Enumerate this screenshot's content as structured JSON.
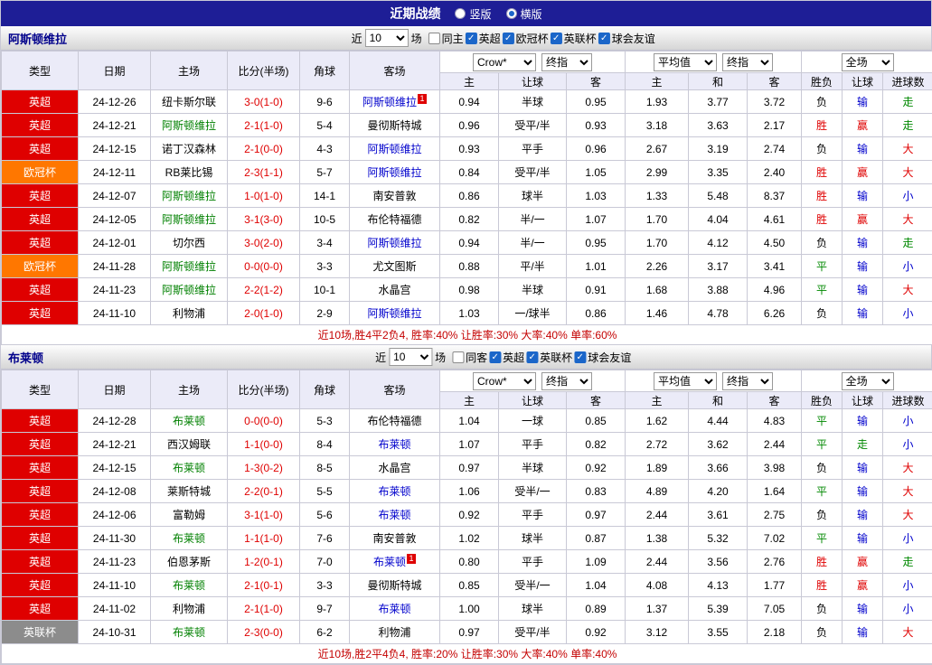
{
  "topbar": {
    "title": "近期战绩",
    "radios": [
      {
        "label": "竖版",
        "selected": false
      },
      {
        "label": "横版",
        "selected": true
      }
    ]
  },
  "colors": {
    "topbar_bg": "#1e1e96",
    "epl_badge": "#df0000",
    "ucl_badge": "#ff7700",
    "league_cup_badge": "#8c8c8c",
    "win_red": "#df0000",
    "draw_green": "#008800",
    "blue": "#0000cc",
    "home_focus_green": "#008000",
    "header_bg": "#ebebf8"
  },
  "filter": {
    "near_label": "近",
    "matches_label": "场",
    "count_value": "10"
  },
  "table": {
    "headers": [
      "类型",
      "日期",
      "主场",
      "比分(半场)",
      "角球",
      "客场"
    ],
    "odds_headers": [
      "主",
      "让球",
      "客"
    ],
    "avg_headers": [
      "主",
      "和",
      "客"
    ],
    "result_headers": [
      "胜负",
      "让球",
      "进球数"
    ],
    "selects": {
      "bookmaker": "Crow*",
      "final1": "终指",
      "avg": "平均值",
      "final2": "终指",
      "scope": "全场"
    }
  },
  "sections": [
    {
      "team": "阿斯顿维拉",
      "filter_checkboxes": [
        {
          "label": "同主",
          "checked": false
        },
        {
          "label": "英超",
          "checked": true
        },
        {
          "label": "欧冠杯",
          "checked": true
        },
        {
          "label": "英联杯",
          "checked": true
        },
        {
          "label": "球会友谊",
          "checked": true
        }
      ],
      "rows": [
        {
          "league": "英超",
          "league_color": "epl",
          "date": "24-12-26",
          "home": "纽卡斯尔联",
          "home_focus": false,
          "score": "3-0(1-0)",
          "corners": "9-6",
          "away": "阿斯顿维拉",
          "away_focus": true,
          "away_badge": "1",
          "odds": [
            "0.94",
            "半球",
            "0.95"
          ],
          "avg": [
            "1.93",
            "3.77",
            "3.72"
          ],
          "wdl": "负",
          "wdl_color": "black",
          "handicap_result": "输",
          "hr_color": "blue",
          "goals": "走",
          "goals_color": "green"
        },
        {
          "league": "英超",
          "league_color": "epl",
          "date": "24-12-21",
          "home": "阿斯顿维拉",
          "home_focus": true,
          "score": "2-1(1-0)",
          "corners": "5-4",
          "away": "曼彻斯特城",
          "away_focus": false,
          "odds": [
            "0.96",
            "受平/半",
            "0.93"
          ],
          "avg": [
            "3.18",
            "3.63",
            "2.17"
          ],
          "wdl": "胜",
          "wdl_color": "red",
          "handicap_result": "赢",
          "hr_color": "red",
          "goals": "走",
          "goals_color": "green"
        },
        {
          "league": "英超",
          "league_color": "epl",
          "date": "24-12-15",
          "home": "诺丁汉森林",
          "home_focus": false,
          "score": "2-1(0-0)",
          "corners": "4-3",
          "away": "阿斯顿维拉",
          "away_focus": true,
          "odds": [
            "0.93",
            "平手",
            "0.96"
          ],
          "avg": [
            "2.67",
            "3.19",
            "2.74"
          ],
          "wdl": "负",
          "wdl_color": "black",
          "handicap_result": "输",
          "hr_color": "blue",
          "goals": "大",
          "goals_color": "red"
        },
        {
          "league": "欧冠杯",
          "league_color": "ucl",
          "date": "24-12-11",
          "home": "RB莱比锡",
          "home_focus": false,
          "score": "2-3(1-1)",
          "corners": "5-7",
          "away": "阿斯顿维拉",
          "away_focus": true,
          "odds": [
            "0.84",
            "受平/半",
            "1.05"
          ],
          "avg": [
            "2.99",
            "3.35",
            "2.40"
          ],
          "wdl": "胜",
          "wdl_color": "red",
          "handicap_result": "赢",
          "hr_color": "red",
          "goals": "大",
          "goals_color": "red"
        },
        {
          "league": "英超",
          "league_color": "epl",
          "date": "24-12-07",
          "home": "阿斯顿维拉",
          "home_focus": true,
          "score": "1-0(1-0)",
          "corners": "14-1",
          "away": "南安普敦",
          "away_focus": false,
          "odds": [
            "0.86",
            "球半",
            "1.03"
          ],
          "avg": [
            "1.33",
            "5.48",
            "8.37"
          ],
          "wdl": "胜",
          "wdl_color": "red",
          "handicap_result": "输",
          "hr_color": "blue",
          "goals": "小",
          "goals_color": "blue"
        },
        {
          "league": "英超",
          "league_color": "epl",
          "date": "24-12-05",
          "home": "阿斯顿维拉",
          "home_focus": true,
          "score": "3-1(3-0)",
          "corners": "10-5",
          "away": "布伦特福德",
          "away_focus": false,
          "odds": [
            "0.82",
            "半/一",
            "1.07"
          ],
          "avg": [
            "1.70",
            "4.04",
            "4.61"
          ],
          "wdl": "胜",
          "wdl_color": "red",
          "handicap_result": "赢",
          "hr_color": "red",
          "goals": "大",
          "goals_color": "red"
        },
        {
          "league": "英超",
          "league_color": "epl",
          "date": "24-12-01",
          "home": "切尔西",
          "home_focus": false,
          "score": "3-0(2-0)",
          "corners": "3-4",
          "away": "阿斯顿维拉",
          "away_focus": true,
          "odds": [
            "0.94",
            "半/一",
            "0.95"
          ],
          "avg": [
            "1.70",
            "4.12",
            "4.50"
          ],
          "wdl": "负",
          "wdl_color": "black",
          "handicap_result": "输",
          "hr_color": "blue",
          "goals": "走",
          "goals_color": "green"
        },
        {
          "league": "欧冠杯",
          "league_color": "ucl",
          "date": "24-11-28",
          "home": "阿斯顿维拉",
          "home_focus": true,
          "score": "0-0(0-0)",
          "corners": "3-3",
          "away": "尤文图斯",
          "away_focus": false,
          "odds": [
            "0.88",
            "平/半",
            "1.01"
          ],
          "avg": [
            "2.26",
            "3.17",
            "3.41"
          ],
          "wdl": "平",
          "wdl_color": "green",
          "handicap_result": "输",
          "hr_color": "blue",
          "goals": "小",
          "goals_color": "blue"
        },
        {
          "league": "英超",
          "league_color": "epl",
          "date": "24-11-23",
          "home": "阿斯顿维拉",
          "home_focus": true,
          "score": "2-2(1-2)",
          "corners": "10-1",
          "away": "水晶宫",
          "away_focus": false,
          "odds": [
            "0.98",
            "半球",
            "0.91"
          ],
          "avg": [
            "1.68",
            "3.88",
            "4.96"
          ],
          "wdl": "平",
          "wdl_color": "green",
          "handicap_result": "输",
          "hr_color": "blue",
          "goals": "大",
          "goals_color": "red"
        },
        {
          "league": "英超",
          "league_color": "epl",
          "date": "24-11-10",
          "home": "利物浦",
          "home_focus": false,
          "score": "2-0(1-0)",
          "corners": "2-9",
          "away": "阿斯顿维拉",
          "away_focus": true,
          "odds": [
            "1.03",
            "一/球半",
            "0.86"
          ],
          "avg": [
            "1.46",
            "4.78",
            "6.26"
          ],
          "wdl": "负",
          "wdl_color": "black",
          "handicap_result": "输",
          "hr_color": "blue",
          "goals": "小",
          "goals_color": "blue"
        }
      ],
      "summary": "近10场,胜4平2负4, 胜率:40% 让胜率:30% 大率:40% 单率:60%"
    },
    {
      "team": "布莱顿",
      "filter_checkboxes": [
        {
          "label": "同客",
          "checked": false
        },
        {
          "label": "英超",
          "checked": true
        },
        {
          "label": "英联杯",
          "checked": true
        },
        {
          "label": "球会友谊",
          "checked": true
        }
      ],
      "rows": [
        {
          "league": "英超",
          "league_color": "epl",
          "date": "24-12-28",
          "home": "布莱顿",
          "home_focus": true,
          "score": "0-0(0-0)",
          "corners": "5-3",
          "away": "布伦特福德",
          "away_focus": false,
          "odds": [
            "1.04",
            "一球",
            "0.85"
          ],
          "avg": [
            "1.62",
            "4.44",
            "4.83"
          ],
          "wdl": "平",
          "wdl_color": "green",
          "handicap_result": "输",
          "hr_color": "blue",
          "goals": "小",
          "goals_color": "blue"
        },
        {
          "league": "英超",
          "league_color": "epl",
          "date": "24-12-21",
          "home": "西汉姆联",
          "home_focus": false,
          "score": "1-1(0-0)",
          "corners": "8-4",
          "away": "布莱顿",
          "away_focus": true,
          "odds": [
            "1.07",
            "平手",
            "0.82"
          ],
          "avg": [
            "2.72",
            "3.62",
            "2.44"
          ],
          "wdl": "平",
          "wdl_color": "green",
          "handicap_result": "走",
          "hr_color": "green",
          "goals": "小",
          "goals_color": "blue"
        },
        {
          "league": "英超",
          "league_color": "epl",
          "date": "24-12-15",
          "home": "布莱顿",
          "home_focus": true,
          "score": "1-3(0-2)",
          "corners": "8-5",
          "away": "水晶宫",
          "away_focus": false,
          "odds": [
            "0.97",
            "半球",
            "0.92"
          ],
          "avg": [
            "1.89",
            "3.66",
            "3.98"
          ],
          "wdl": "负",
          "wdl_color": "black",
          "handicap_result": "输",
          "hr_color": "blue",
          "goals": "大",
          "goals_color": "red"
        },
        {
          "league": "英超",
          "league_color": "epl",
          "date": "24-12-08",
          "home": "莱斯特城",
          "home_focus": false,
          "score": "2-2(0-1)",
          "corners": "5-5",
          "away": "布莱顿",
          "away_focus": true,
          "odds": [
            "1.06",
            "受半/一",
            "0.83"
          ],
          "avg": [
            "4.89",
            "4.20",
            "1.64"
          ],
          "wdl": "平",
          "wdl_color": "green",
          "handicap_result": "输",
          "hr_color": "blue",
          "goals": "大",
          "goals_color": "red"
        },
        {
          "league": "英超",
          "league_color": "epl",
          "date": "24-12-06",
          "home": "富勒姆",
          "home_focus": false,
          "score": "3-1(1-0)",
          "corners": "5-6",
          "away": "布莱顿",
          "away_focus": true,
          "odds": [
            "0.92",
            "平手",
            "0.97"
          ],
          "avg": [
            "2.44",
            "3.61",
            "2.75"
          ],
          "wdl": "负",
          "wdl_color": "black",
          "handicap_result": "输",
          "hr_color": "blue",
          "goals": "大",
          "goals_color": "red"
        },
        {
          "league": "英超",
          "league_color": "epl",
          "date": "24-11-30",
          "home": "布莱顿",
          "home_focus": true,
          "score": "1-1(1-0)",
          "corners": "7-6",
          "away": "南安普敦",
          "away_focus": false,
          "odds": [
            "1.02",
            "球半",
            "0.87"
          ],
          "avg": [
            "1.38",
            "5.32",
            "7.02"
          ],
          "wdl": "平",
          "wdl_color": "green",
          "handicap_result": "输",
          "hr_color": "blue",
          "goals": "小",
          "goals_color": "blue"
        },
        {
          "league": "英超",
          "league_color": "epl",
          "date": "24-11-23",
          "home": "伯恩茅斯",
          "home_focus": false,
          "score": "1-2(0-1)",
          "corners": "7-0",
          "away": "布莱顿",
          "away_focus": true,
          "away_badge": "1",
          "odds": [
            "0.80",
            "平手",
            "1.09"
          ],
          "avg": [
            "2.44",
            "3.56",
            "2.76"
          ],
          "wdl": "胜",
          "wdl_color": "red",
          "handicap_result": "赢",
          "hr_color": "red",
          "goals": "走",
          "goals_color": "green"
        },
        {
          "league": "英超",
          "league_color": "epl",
          "date": "24-11-10",
          "home": "布莱顿",
          "home_focus": true,
          "score": "2-1(0-1)",
          "corners": "3-3",
          "away": "曼彻斯特城",
          "away_focus": false,
          "odds": [
            "0.85",
            "受半/一",
            "1.04"
          ],
          "avg": [
            "4.08",
            "4.13",
            "1.77"
          ],
          "wdl": "胜",
          "wdl_color": "red",
          "handicap_result": "赢",
          "hr_color": "red",
          "goals": "小",
          "goals_color": "blue"
        },
        {
          "league": "英超",
          "league_color": "epl",
          "date": "24-11-02",
          "home": "利物浦",
          "home_focus": false,
          "score": "2-1(1-0)",
          "corners": "9-7",
          "away": "布莱顿",
          "away_focus": true,
          "odds": [
            "1.00",
            "球半",
            "0.89"
          ],
          "avg": [
            "1.37",
            "5.39",
            "7.05"
          ],
          "wdl": "负",
          "wdl_color": "black",
          "handicap_result": "输",
          "hr_color": "blue",
          "goals": "小",
          "goals_color": "blue"
        },
        {
          "league": "英联杯",
          "league_color": "lc",
          "date": "24-10-31",
          "home": "布莱顿",
          "home_focus": true,
          "score": "2-3(0-0)",
          "corners": "6-2",
          "away": "利物浦",
          "away_focus": false,
          "odds": [
            "0.97",
            "受平/半",
            "0.92"
          ],
          "avg": [
            "3.12",
            "3.55",
            "2.18"
          ],
          "wdl": "负",
          "wdl_color": "black",
          "handicap_result": "输",
          "hr_color": "blue",
          "goals": "大",
          "goals_color": "red"
        }
      ],
      "summary": "近10场,胜2平4负4, 胜率:20% 让胜率:30% 大率:40% 单率:40%"
    }
  ]
}
